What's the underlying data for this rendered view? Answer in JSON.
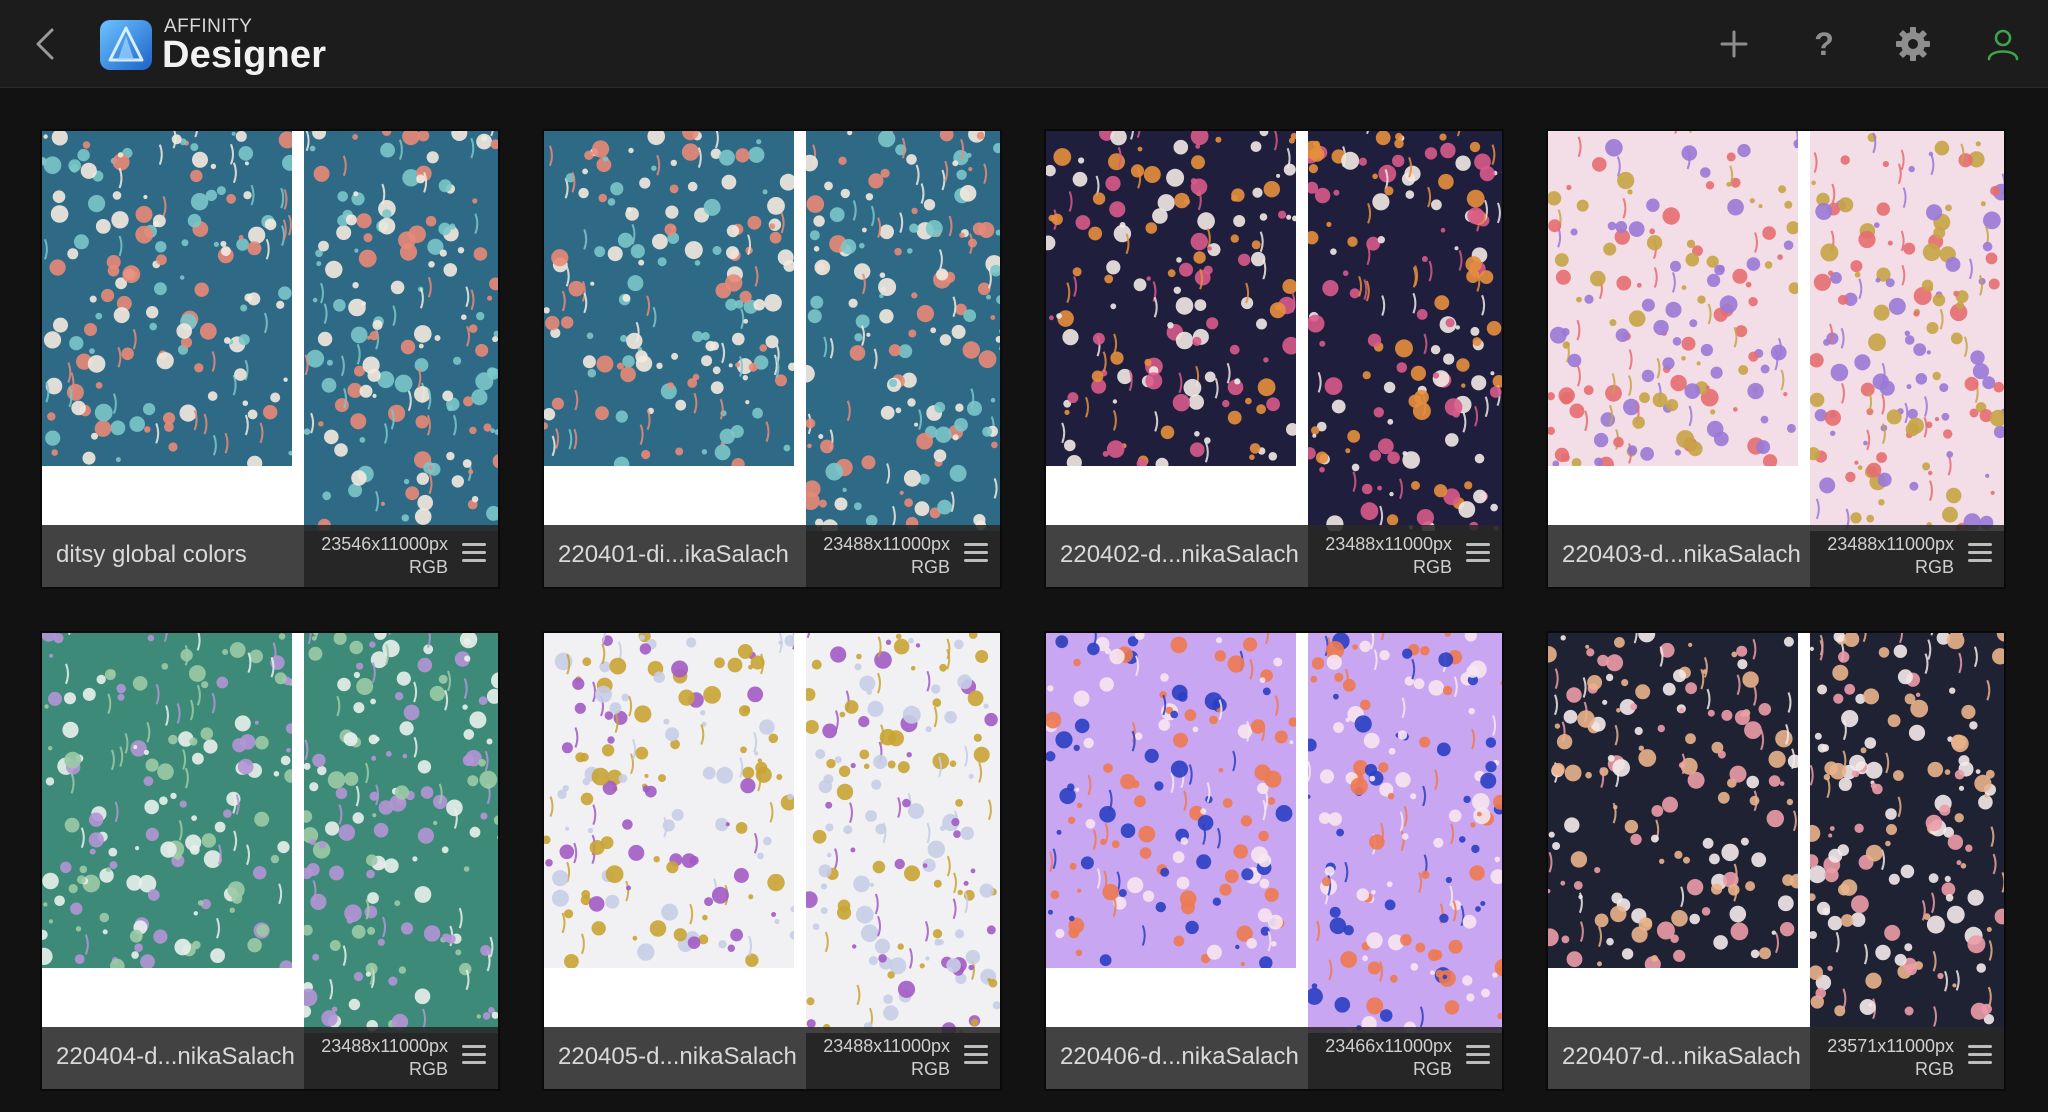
{
  "app": {
    "brand_top": "AFFINITY",
    "brand_main": "Designer"
  },
  "toolbar": {
    "back_icon": "chevron-left-icon",
    "new_icon": "plus-icon",
    "help_icon": "question-icon",
    "help_glyph": "?",
    "settings_icon": "gear-icon",
    "account_icon": "user-icon"
  },
  "colors": {
    "accent_user": "#3fa34d",
    "logo_blue": "#3b8fe0",
    "topbar": "#1c1c1c"
  },
  "documents": [
    {
      "name": "ditsy global colors",
      "size": "23546x11000px",
      "mode": "RGB",
      "bg": "#2e6a86",
      "f1": "#e98a78",
      "f2": "#f3eadf",
      "f3": "#7bc6c9"
    },
    {
      "name": "220401-di...ikaSalach",
      "size": "23488x11000px",
      "mode": "RGB",
      "bg": "#2e6a86",
      "f1": "#e98a78",
      "f2": "#f3eadf",
      "f3": "#7bc6c9"
    },
    {
      "name": "220402-d...nikaSalach",
      "size": "23488x11000px",
      "mode": "RGB",
      "bg": "#1f1f3d",
      "f1": "#e58f3c",
      "f2": "#f1e9e4",
      "f3": "#d85a8a"
    },
    {
      "name": "220403-d...nikaSalach",
      "size": "23488x11000px",
      "mode": "RGB",
      "bg": "#f3dde6",
      "f1": "#e56d70",
      "f2": "#9a79d6",
      "f3": "#c6a446"
    },
    {
      "name": "220404-d...nikaSalach",
      "size": "23488x11000px",
      "mode": "RGB",
      "bg": "#3d8a78",
      "f1": "#e9f0ec",
      "f2": "#b495d6",
      "f3": "#9ccaa6"
    },
    {
      "name": "220405-d...nikaSalach",
      "size": "23488x11000px",
      "mode": "RGB",
      "bg": "#f1f1f4",
      "f1": "#a25bc4",
      "f2": "#c6cde6",
      "f3": "#c9a434"
    },
    {
      "name": "220406-d...nikaSalach",
      "size": "23466x11000px",
      "mode": "RGB",
      "bg": "#c9a6f1",
      "f1": "#2a3fc2",
      "f2": "#ee7a50",
      "f3": "#f7e6ee"
    },
    {
      "name": "220407-d...nikaSalach",
      "size": "23571x11000px",
      "mode": "RGB",
      "bg": "#1f2233",
      "f1": "#ec9ca8",
      "f2": "#e9b28b",
      "f3": "#f3eaea"
    }
  ]
}
